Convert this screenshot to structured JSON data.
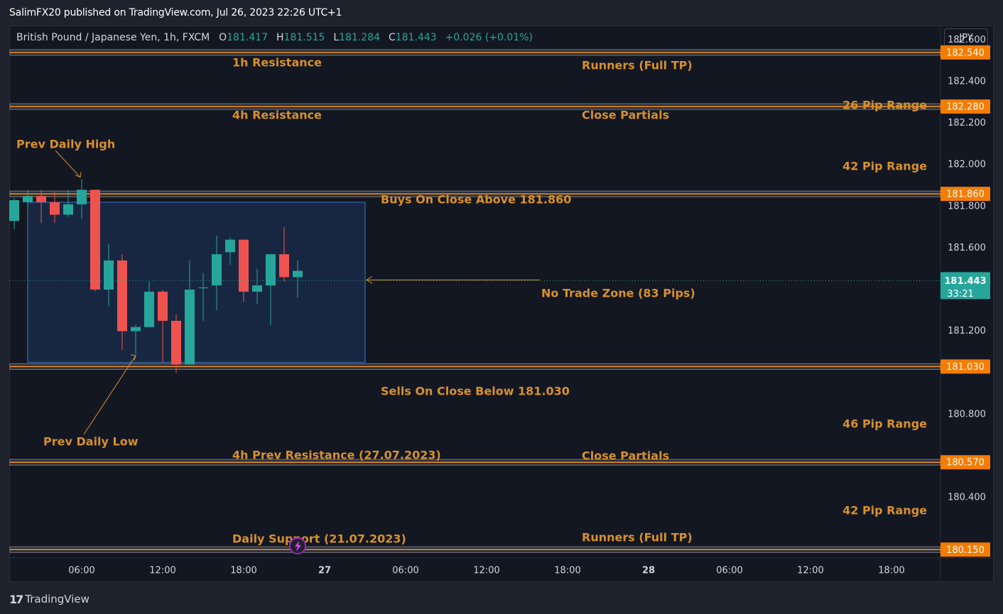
{
  "published_text": "SalimFX20 published on TradingView.com, Jul 26, 2023 22:26 UTC+1",
  "symbol": {
    "name": "British Pound / Japanese Yen, 1h, FXCM",
    "open_label": "O",
    "open": "181.417",
    "high_label": "H",
    "high": "181.515",
    "low_label": "L",
    "low": "181.284",
    "close_label": "C",
    "close": "181.443",
    "change": "+0.026 (+0.01%)"
  },
  "currency_button": "JPY",
  "footer": {
    "brand": "TradingView",
    "logo_glyph": "17"
  },
  "colors": {
    "up": "#26a69a",
    "down": "#ef5350",
    "level": "#f7931a",
    "annotation_text": "#d7902c",
    "zone_fill": "#1a2a47",
    "zone_border": "#3d74c7",
    "price_badge": "#f57c00",
    "current_badge": "#26a69a"
  },
  "chart_data": {
    "type": "candlestick",
    "timeframe": "1h",
    "ylim": [
      180.11,
      182.666
    ],
    "y_ticks": [
      "182.600",
      "182.400",
      "182.200",
      "182.000",
      "181.800",
      "181.600",
      "181.200",
      "180.800",
      "180.400"
    ],
    "x_ticks": [
      {
        "label": "06:00",
        "index": 5,
        "bold": false
      },
      {
        "label": "12:00",
        "index": 11,
        "bold": false
      },
      {
        "label": "18:00",
        "index": 17,
        "bold": false
      },
      {
        "label": "27",
        "index": 23,
        "bold": true
      },
      {
        "label": "06:00",
        "index": 29,
        "bold": false
      },
      {
        "label": "12:00",
        "index": 35,
        "bold": false
      },
      {
        "label": "18:00",
        "index": 41,
        "bold": false
      },
      {
        "label": "28",
        "index": 47,
        "bold": true
      },
      {
        "label": "06:00",
        "index": 53,
        "bold": false
      },
      {
        "label": "12:00",
        "index": 59,
        "bold": false
      },
      {
        "label": "18:00",
        "index": 65,
        "bold": false
      }
    ],
    "candles": [
      {
        "o": 181.73,
        "h": 181.84,
        "l": 181.69,
        "c": 181.83
      },
      {
        "o": 181.82,
        "h": 181.88,
        "l": 181.78,
        "c": 181.85
      },
      {
        "o": 181.85,
        "h": 181.88,
        "l": 181.72,
        "c": 181.82
      },
      {
        "o": 181.82,
        "h": 181.87,
        "l": 181.72,
        "c": 181.76
      },
      {
        "o": 181.76,
        "h": 181.88,
        "l": 181.75,
        "c": 181.81
      },
      {
        "o": 181.81,
        "h": 181.93,
        "l": 181.74,
        "c": 181.88
      },
      {
        "o": 181.88,
        "h": 181.88,
        "l": 181.39,
        "c": 181.4
      },
      {
        "o": 181.4,
        "h": 181.62,
        "l": 181.32,
        "c": 181.54
      },
      {
        "o": 181.54,
        "h": 181.57,
        "l": 181.11,
        "c": 181.2
      },
      {
        "o": 181.2,
        "h": 181.23,
        "l": 181.09,
        "c": 181.22
      },
      {
        "o": 181.22,
        "h": 181.44,
        "l": 181.22,
        "c": 181.39
      },
      {
        "o": 181.39,
        "h": 181.4,
        "l": 181.05,
        "c": 181.25
      },
      {
        "o": 181.25,
        "h": 181.28,
        "l": 181.0,
        "c": 181.04
      },
      {
        "o": 181.04,
        "h": 181.54,
        "l": 181.04,
        "c": 181.4
      },
      {
        "o": 181.41,
        "h": 181.48,
        "l": 181.25,
        "c": 181.41
      },
      {
        "o": 181.42,
        "h": 181.66,
        "l": 181.3,
        "c": 181.57
      },
      {
        "o": 181.58,
        "h": 181.65,
        "l": 181.52,
        "c": 181.64
      },
      {
        "o": 181.64,
        "h": 181.64,
        "l": 181.34,
        "c": 181.39
      },
      {
        "o": 181.39,
        "h": 181.5,
        "l": 181.33,
        "c": 181.42
      },
      {
        "o": 181.42,
        "h": 181.56,
        "l": 181.23,
        "c": 181.57
      },
      {
        "o": 181.57,
        "h": 181.7,
        "l": 181.44,
        "c": 181.46
      },
      {
        "o": 181.46,
        "h": 181.54,
        "l": 181.36,
        "c": 181.49
      }
    ],
    "current_price": "181.443",
    "countdown": "33:21",
    "levels": [
      {
        "price": 182.54,
        "label": "182.540"
      },
      {
        "price": 182.28,
        "label": "182.280"
      },
      {
        "price": 181.86,
        "label": "181.860"
      },
      {
        "price": 181.03,
        "label": "181.030"
      },
      {
        "price": 180.57,
        "label": "180.570"
      },
      {
        "price": 180.15,
        "label": "180.150"
      }
    ],
    "zone": {
      "from_index": 1,
      "to_index": 26,
      "top": 181.82,
      "bottom": 181.05
    },
    "annotations": {
      "res_1h": "1h Resistance",
      "runners_top": "Runners (Full TP)",
      "res_4h": "4h Resistance",
      "close_partials_top": "Close Partials",
      "range_26": "26 Pip Range",
      "prev_daily_high": "Prev Daily High",
      "range_42_top": "42 Pip Range",
      "buys": "Buys On Close Above 181.860",
      "no_trade": "No Trade Zone (83 Pips)",
      "sells": "Sells On Close Below 181.030",
      "range_46": "46 Pip Range",
      "prev_daily_low": "Prev Daily Low",
      "prev_res_4h": "4h Prev Resistance (27.07.2023)",
      "close_partials_bottom": "Close Partials",
      "range_42_bottom": "42 Pip Range",
      "daily_support": "Daily Support (21.07.2023)",
      "runners_bottom": "Runners (Full TP)"
    }
  }
}
